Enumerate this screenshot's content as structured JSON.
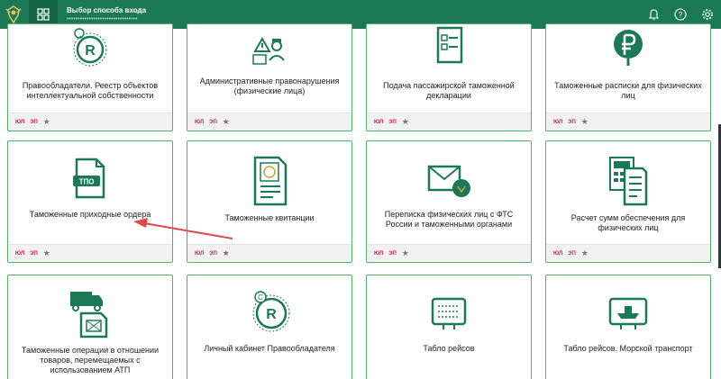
{
  "header": {
    "title": "Выбор способа входа",
    "subtitle": "••••••••••••••••••••••••••••••••",
    "bg_color": "#1b7a55",
    "icons": [
      "bell-icon",
      "question-icon",
      "settings-icon"
    ]
  },
  "cards": [
    {
      "label": "Правообладатели. Реестр объектов интеллектуальной собственности",
      "icon": "registered-icon",
      "tags": [
        "ЮЛ",
        "ЭП"
      ]
    },
    {
      "label": "Административные правонарушения (физические лица)",
      "icon": "officer-warning-icon",
      "tags": [
        "ЮЛ",
        "ЭП"
      ]
    },
    {
      "label": "Подача пассажирской таможенной декларации",
      "icon": "declaration-form-icon",
      "tags": [
        "ЮЛ",
        "ЭП"
      ]
    },
    {
      "label": "Таможенные расписки для физических лиц",
      "icon": "ruble-icon",
      "tags": [
        "ЮЛ",
        "ЭП"
      ]
    },
    {
      "label": "Таможенные приходные ордера",
      "icon": "tpo-document-icon",
      "tags": [
        "ЮЛ",
        "ЭП"
      ]
    },
    {
      "label": "Таможенные квитанции",
      "icon": "customs-receipt-icon",
      "tags": [
        "ЮЛ",
        "ЭП"
      ]
    },
    {
      "label": "Переписка физических лиц с ФТС России и таможенными органами",
      "icon": "envelope-emblem-icon",
      "tags": [
        "ЮЛ",
        "ЭП"
      ]
    },
    {
      "label": "Расчет сумм обеспечения для физических лиц",
      "icon": "calculator-document-icon",
      "tags": [
        "ЮЛ",
        "ЭП"
      ]
    },
    {
      "label": "Таможенные операции в отношении товаров, перемещаемых с использованием АТП",
      "icon": "truck-document-icon",
      "tags": []
    },
    {
      "label": "Личный кабинет Правообладателя",
      "icon": "copyright-registered-icon",
      "tags": []
    },
    {
      "label": "Табло рейсов",
      "icon": "flight-board-icon",
      "tags": []
    },
    {
      "label": "Табло рейсов. Морской транспорт",
      "icon": "ship-board-icon",
      "tags": []
    }
  ],
  "colors": {
    "accent": "#1b7a55",
    "card_border": "#53b06a",
    "tag": "#c2243c",
    "arrow": "#e04848"
  }
}
